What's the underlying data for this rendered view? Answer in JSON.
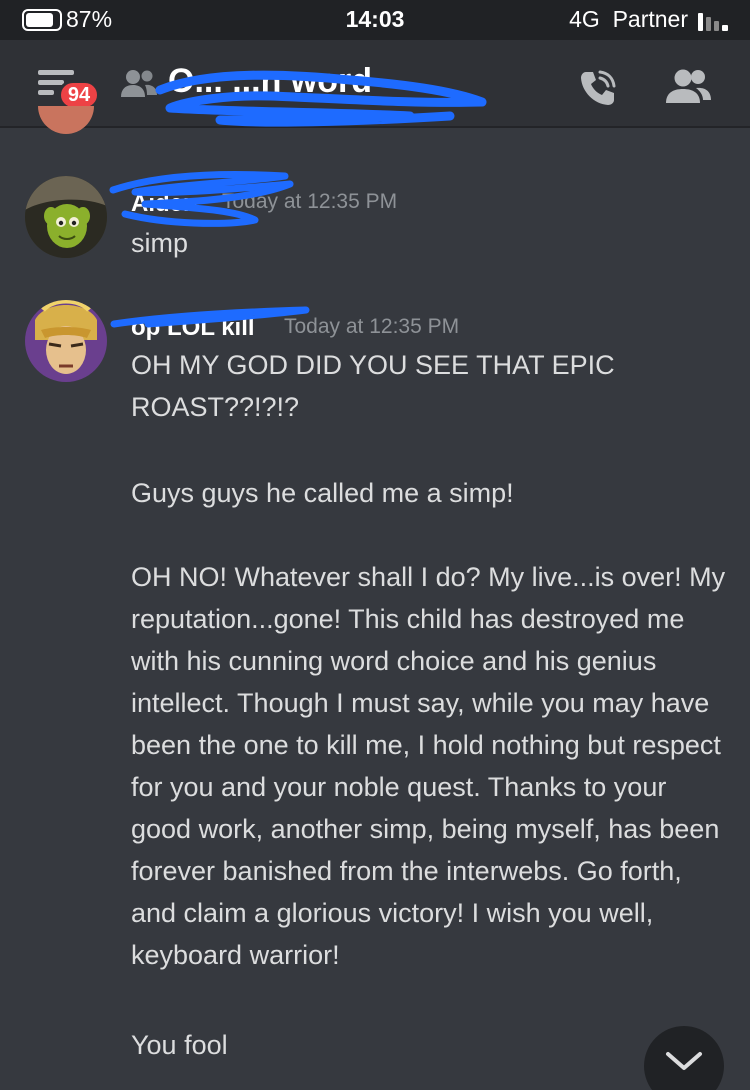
{
  "status_bar": {
    "battery_percent": "87%",
    "battery_level": 0.87,
    "time": "14:03",
    "network": "4G",
    "carrier": "Partner"
  },
  "header": {
    "unread_badge": "94",
    "channel_name_visible": "O... ...n word",
    "icons": [
      "hamburger-menu-icon",
      "group-dm-icon",
      "phone-call-icon",
      "members-icon"
    ]
  },
  "messages": [
    {
      "username": "Aiden",
      "timestamp": "Today at 12:35 PM",
      "text": "simp"
    },
    {
      "username": "op LOL kill",
      "timestamp": "Today at 12:35 PM",
      "paragraphs": [
        "OH MY GOD DID YOU SEE THAT EPIC ROAST??!?!?",
        "Guys guys he called me a simp!",
        "OH NO! Whatever shall I do? My live...is over! My reputation...gone! This child has destroyed me with his cunning word choice and his genius intellect. Though I must say, while you may have been the one to kill me, I hold nothing but respect for you and your noble quest. Thanks to your good work, another simp, being myself, has been forever banished from the interwebs. Go forth, and claim a glorious victory! I wish you well, keyboard warrior!",
        "You fool"
      ]
    }
  ],
  "colors": {
    "background": "#36393f",
    "header": "#2f3136",
    "status_bar": "#202225",
    "badge": "#ed4245",
    "scribble": "#1e6bff"
  }
}
